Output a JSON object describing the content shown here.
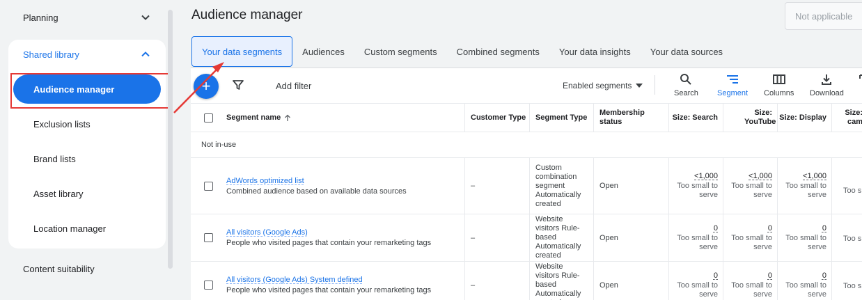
{
  "sidebar": {
    "planning": "Planning",
    "shared_library": "Shared library",
    "items": [
      {
        "label": "Audience manager"
      },
      {
        "label": "Exclusion lists"
      },
      {
        "label": "Brand lists"
      },
      {
        "label": "Asset library"
      },
      {
        "label": "Location manager"
      }
    ],
    "content_suitability": "Content suitability"
  },
  "header": {
    "title": "Audience manager",
    "status_box": "Not applicable"
  },
  "tabs": [
    {
      "label": "Your data segments"
    },
    {
      "label": "Audiences"
    },
    {
      "label": "Custom segments"
    },
    {
      "label": "Combined segments"
    },
    {
      "label": "Your data insights"
    },
    {
      "label": "Your data sources"
    }
  ],
  "toolbar": {
    "fab_icon": "+",
    "add_filter": "Add filter",
    "enabled_segments": "Enabled segments",
    "tools": [
      {
        "label": "Search",
        "icon": "search-icon"
      },
      {
        "label": "Segment",
        "icon": "segment-icon"
      },
      {
        "label": "Columns",
        "icon": "columns-icon"
      },
      {
        "label": "Download",
        "icon": "download-icon"
      },
      {
        "label": "E",
        "icon": "expand-icon"
      }
    ]
  },
  "table": {
    "headers": {
      "segment_name": "Segment name",
      "customer_type": "Customer Type",
      "segment_type": "Segment Type",
      "membership_status": "Membership status",
      "size_search": "Size: Search",
      "size_youtube": "Size: YouTube",
      "size_display": "Size: Display",
      "size_cut_top": "Size:",
      "size_cut_bottom": "cam"
    },
    "group_label": "Not in-use",
    "rows": [
      {
        "name": "AdWords optimized list",
        "desc": "Combined audience based on available data sources",
        "customer_type": "–",
        "segment_type": "Custom combination segment Automatically created",
        "membership": "Open",
        "size_search": "<1,000",
        "size_youtube": "<1,000",
        "size_display": "<1,000",
        "note": "Too small to serve",
        "cut_note": "Too s"
      },
      {
        "name": "All visitors (Google Ads)",
        "desc": "People who visited pages that contain your remarketing tags",
        "customer_type": "–",
        "segment_type": "Website visitors Rule-based Automatically created",
        "membership": "Open",
        "size_search": "0",
        "size_youtube": "0",
        "size_display": "0",
        "note": "Too small to serve",
        "cut_note": "Too s"
      },
      {
        "name": "All visitors (Google Ads) System defined",
        "desc": "People who visited pages that contain your remarketing tags",
        "customer_type": "–",
        "segment_type": "Website visitors Rule-based Automatically created",
        "membership": "Open",
        "size_search": "0",
        "size_youtube": "0",
        "size_display": "0",
        "note": "Too small to serve",
        "cut_note": "Too s"
      }
    ]
  },
  "colors": {
    "accent": "#1a73e8",
    "annotation": "#e53935"
  }
}
